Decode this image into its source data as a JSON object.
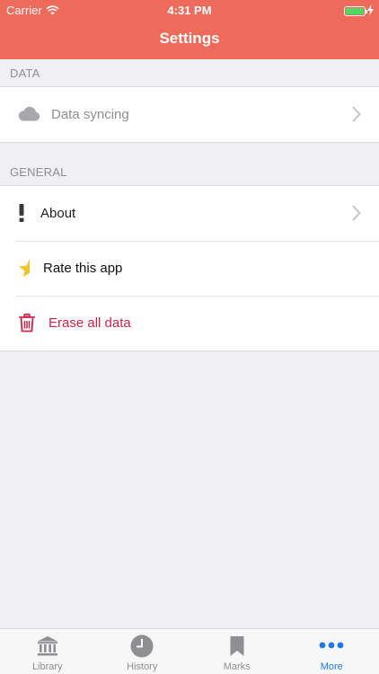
{
  "status_bar": {
    "carrier": "Carrier",
    "time": "4:31 PM",
    "battery_color": "#4cd964"
  },
  "nav": {
    "title": "Settings",
    "color": "#ee6a5a"
  },
  "sections": [
    {
      "header": "DATA",
      "rows": [
        {
          "label": "Data syncing",
          "icon": "cloud-icon",
          "chevron": true,
          "state": "disabled"
        }
      ]
    },
    {
      "header": "GENERAL",
      "rows": [
        {
          "label": "About",
          "icon": "exclamation-icon",
          "chevron": true
        },
        {
          "label": "Rate this app",
          "icon": "half-star-icon",
          "chevron": false
        },
        {
          "label": "Erase all data",
          "icon": "trash-icon",
          "chevron": false,
          "state": "destructive",
          "color": "#d0234a"
        }
      ]
    }
  ],
  "tab_bar": {
    "active_color": "#1a7ae8",
    "items": [
      {
        "label": "Library",
        "icon": "library-icon",
        "active": false
      },
      {
        "label": "History",
        "icon": "clock-icon",
        "active": false
      },
      {
        "label": "Marks",
        "icon": "bookmark-icon",
        "active": false
      },
      {
        "label": "More",
        "icon": "ellipsis-icon",
        "active": true
      }
    ]
  }
}
